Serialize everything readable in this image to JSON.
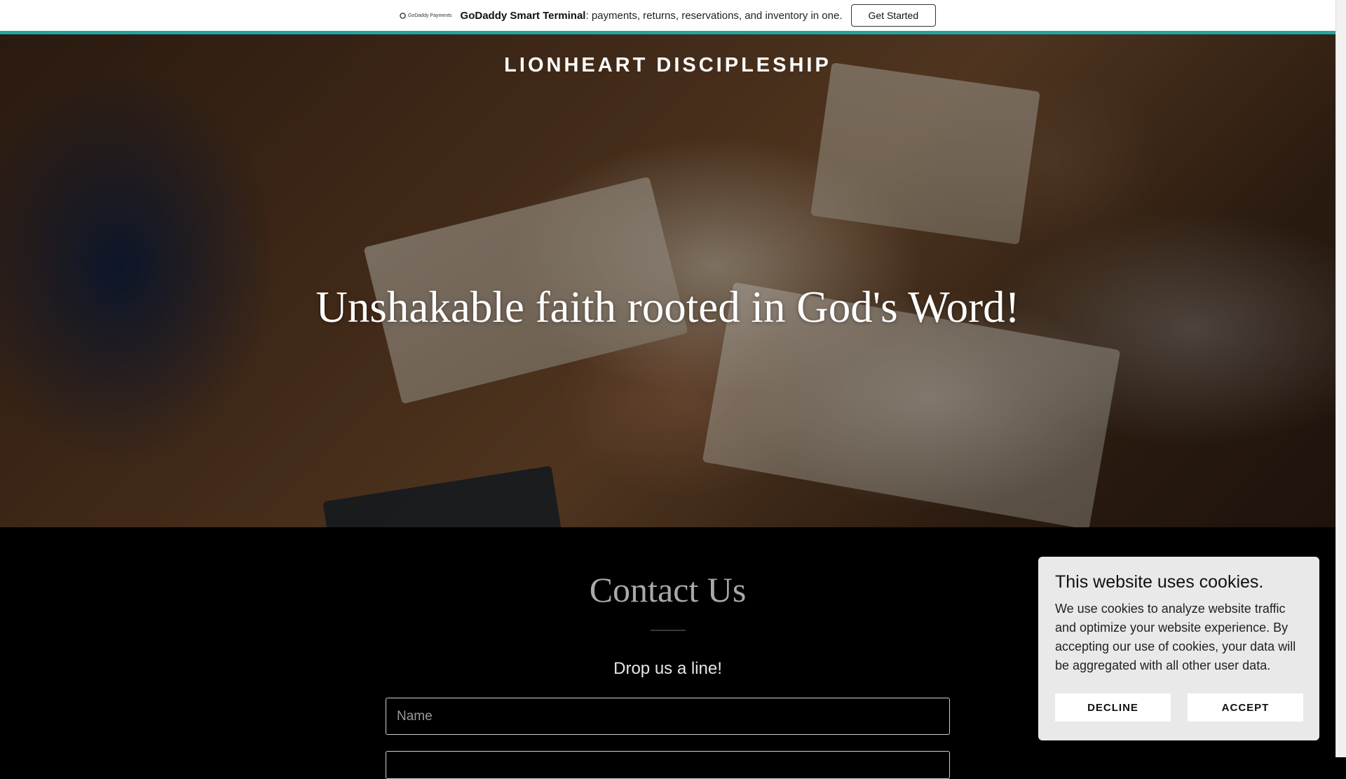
{
  "promo": {
    "logo_text": "GoDaddy Payments",
    "brand": "GoDaddy Smart Terminal",
    "text": ": payments, returns, reservations, and inventory in one.",
    "button": "Get Started",
    "accent_color": "#1fa6a3"
  },
  "header": {
    "site_name": "LIONHEART DISCIPLESHIP"
  },
  "hero": {
    "title": "Unshakable faith rooted in God's Word!"
  },
  "contact": {
    "title": "Contact Us",
    "subtitle": "Drop us a line!",
    "name_placeholder": "Name"
  },
  "cookie": {
    "title": "This website uses cookies.",
    "body": "We use cookies to analyze website traffic and optimize your website experience. By accepting our use of cookies, your data will be aggregated with all other user data.",
    "decline": "DECLINE",
    "accept": "ACCEPT"
  }
}
